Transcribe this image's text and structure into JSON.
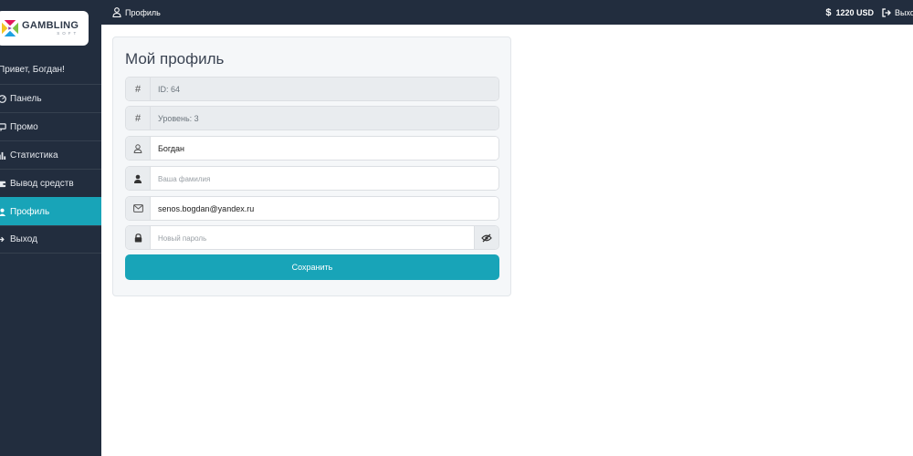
{
  "brand": {
    "name": "GAMBLING",
    "sub": "SOFT"
  },
  "sidebar": {
    "greeting": "Привет, Богдан!",
    "items": [
      {
        "label": "Панель",
        "icon": "dashboard-icon"
      },
      {
        "label": "Промо",
        "icon": "promo-icon"
      },
      {
        "label": "Статистика",
        "icon": "chart-icon"
      },
      {
        "label": "Вывод средств",
        "icon": "wallet-icon"
      },
      {
        "label": "Профиль",
        "icon": "user-icon",
        "active": true
      },
      {
        "label": "Выход",
        "icon": "logout-icon"
      }
    ]
  },
  "topbar": {
    "title": "Профиль",
    "balance": "1220 USD",
    "logout": "Выход"
  },
  "profile": {
    "title": "Мой профиль",
    "id_value": "ID: 64",
    "level_value": "Уровень: 3",
    "first_name_value": "Богдан",
    "last_name_placeholder": "Ваша фамилия",
    "email_value": "senos.bogdan@yandex.ru",
    "password_placeholder": "Новый пароль",
    "save_label": "Сохранить"
  },
  "colors": {
    "sidebar_bg": "#222d3e",
    "accent": "#18a4b8"
  }
}
